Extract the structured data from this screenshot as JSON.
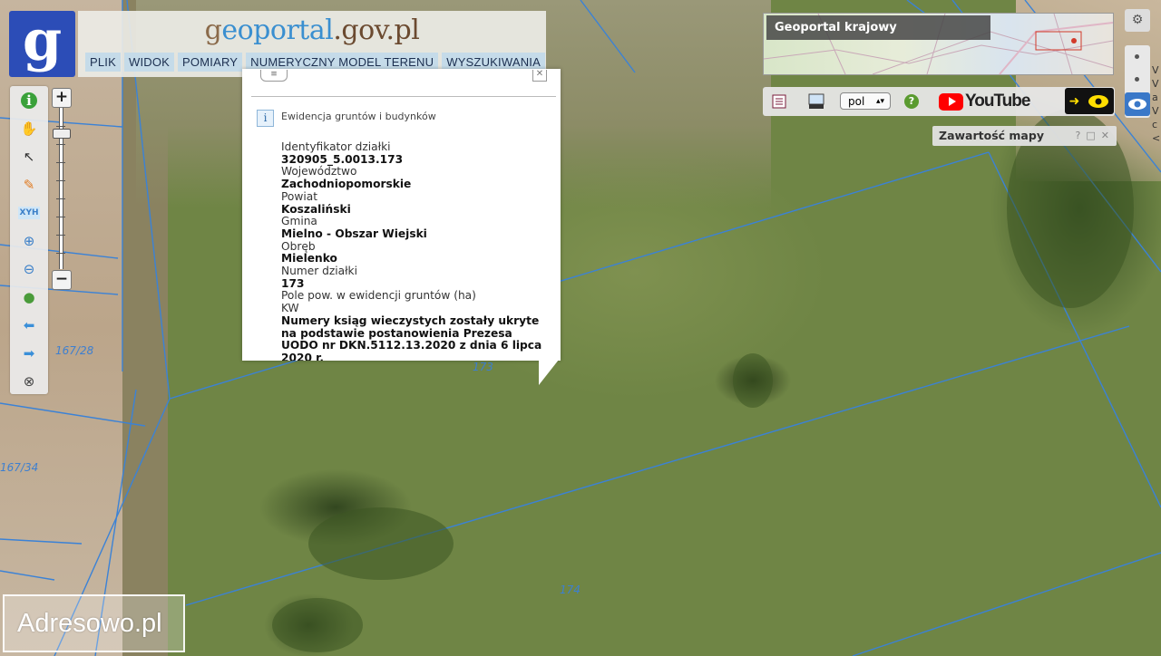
{
  "header": {
    "site_title_part1": "g",
    "site_title_part2": "eoportal",
    "site_title_part3": ".gov.pl",
    "logo_letter": "g",
    "menu": [
      "PLIK",
      "WIDOK",
      "POMIARY",
      "NUMERYCZNY MODEL TERENU",
      "WYSZUKIWANIA"
    ]
  },
  "toolbar": {
    "tools": [
      {
        "name": "info-icon",
        "glyph": "i",
        "color": "#3aa13a"
      },
      {
        "name": "hand-pan-icon",
        "glyph": "✋",
        "color": "#d8a34a"
      },
      {
        "name": "select-arrow-icon",
        "glyph": "↖",
        "color": "#333333"
      },
      {
        "name": "pencil-icon",
        "glyph": "✎",
        "color": "#e07a20"
      },
      {
        "name": "xyh-icon",
        "glyph": "XYH",
        "color": "#3a7fc8"
      },
      {
        "name": "zoom-in-icon",
        "glyph": "⊕",
        "color": "#3a7fc8"
      },
      {
        "name": "zoom-out-icon",
        "glyph": "⊖",
        "color": "#3a7fc8"
      },
      {
        "name": "globe-icon",
        "glyph": "●",
        "color": "#4a9b3a"
      },
      {
        "name": "back-arrow-icon",
        "glyph": "⬅",
        "color": "#3a8fd8"
      },
      {
        "name": "forward-arrow-icon",
        "glyph": "➡",
        "color": "#3a8fd8"
      },
      {
        "name": "reset-icon",
        "glyph": "⊗",
        "color": "#444444"
      }
    ],
    "zoom_in": "+",
    "zoom_out": "−"
  },
  "popup": {
    "layer_icon": "i",
    "layer_name": "Ewidencja gruntów i budynków",
    "fields": [
      {
        "label": "Identyfikator działki",
        "value": "320905_5.0013.173"
      },
      {
        "label": "Województwo",
        "value": "Zachodniopomorskie"
      },
      {
        "label": "Powiat",
        "value": "Koszaliński"
      },
      {
        "label": "Gmina",
        "value": "Mielno - Obszar Wiejski"
      },
      {
        "label": "Obręb",
        "value": "Mielenko"
      },
      {
        "label": "Numer działki",
        "value": "173"
      },
      {
        "label": "Pole pow. w ewidencji gruntów (ha)",
        "value": ""
      },
      {
        "label": "KW",
        "value": "Numery ksiąg wieczystych zostały ukryte na podstawie postanowienia Prezesa UODO nr DKN.5112.13.2020 z dnia 6 lipca 2020 r."
      }
    ]
  },
  "minimap": {
    "title": "Geoportal krajowy"
  },
  "toolstrip": {
    "language": "pol",
    "help": "?",
    "youtube": "YouTube"
  },
  "map_content": {
    "title": "Zawartość mapy",
    "btn_help": "?",
    "btn_max": "□",
    "btn_close": "✕"
  },
  "right_edge_chars": [
    "V",
    "V",
    "a",
    "V",
    "c",
    "<"
  ],
  "map_labels": {
    "p167_28": "167/28",
    "p167_34": "167/34",
    "p173": "173",
    "p174": "174"
  },
  "watermark": "Adresowo.pl",
  "colors": {
    "brand_blue": "#2c4db7",
    "menu_bg": "#c5dbe9",
    "parcel_line": "#3b82d6",
    "youtube_red": "#ff0000"
  }
}
